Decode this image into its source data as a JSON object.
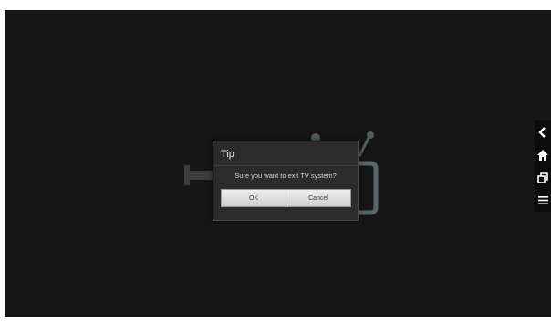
{
  "dialog": {
    "title": "Tip",
    "message": "Sure you want to exit TV system?",
    "ok_label": "OK",
    "cancel_label": "Cancel"
  },
  "side_nav": {
    "items": [
      {
        "icon": "back-icon"
      },
      {
        "icon": "home-icon"
      },
      {
        "icon": "recent-apps-icon"
      },
      {
        "icon": "menu-icon"
      }
    ]
  },
  "colors": {
    "screen_bg": "#161616",
    "dialog_bg": "#2b2b2b",
    "illustration": "#5f7273",
    "button_bg": "#dcdcdc"
  }
}
